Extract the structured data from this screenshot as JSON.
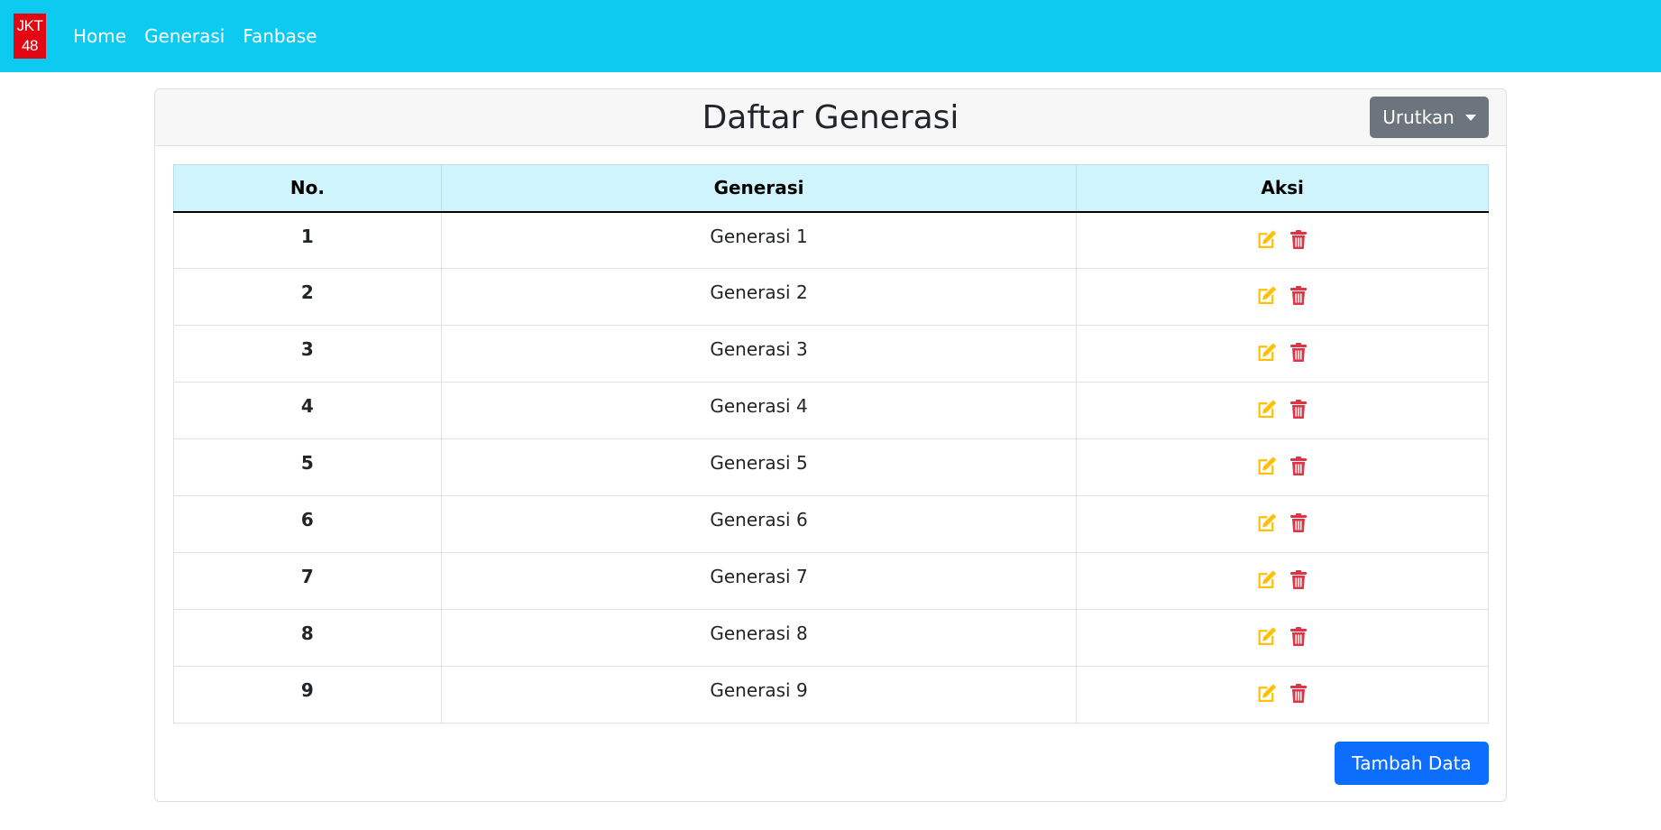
{
  "navbar": {
    "logo": {
      "line1": "JKT",
      "line2": "48",
      "color": "#e30613"
    },
    "links": [
      "Home",
      "Generasi",
      "Fanbase"
    ],
    "background": "#0dcaf0"
  },
  "card": {
    "title": "Daftar Generasi",
    "sort_label": "Urutkan",
    "add_label": "Tambah Data"
  },
  "table": {
    "headers": [
      "No.",
      "Generasi",
      "Aksi"
    ],
    "rows": [
      {
        "no": "1",
        "generasi": "Generasi 1"
      },
      {
        "no": "2",
        "generasi": "Generasi 2"
      },
      {
        "no": "3",
        "generasi": "Generasi 3"
      },
      {
        "no": "4",
        "generasi": "Generasi 4"
      },
      {
        "no": "5",
        "generasi": "Generasi 5"
      },
      {
        "no": "6",
        "generasi": "Generasi 6"
      },
      {
        "no": "7",
        "generasi": "Generasi 7"
      },
      {
        "no": "8",
        "generasi": "Generasi 8"
      },
      {
        "no": "9",
        "generasi": "Generasi 9"
      }
    ],
    "action_icons": [
      "edit-icon",
      "trash-icon"
    ],
    "edit_color": "#ffc107",
    "delete_color": "#dc3545"
  }
}
